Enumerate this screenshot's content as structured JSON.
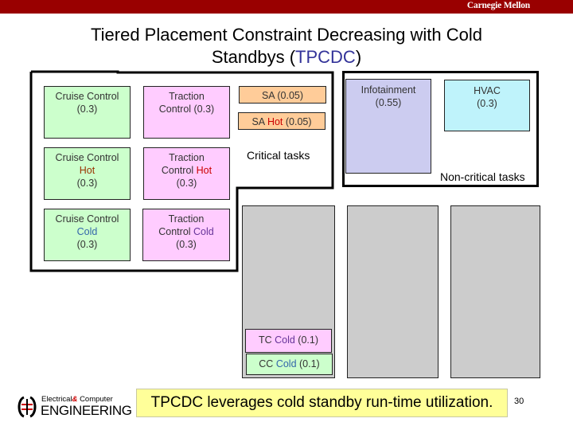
{
  "header": {
    "brand": "Carnegie Mellon",
    "brand_bar_color": "#990000"
  },
  "title": {
    "line1": "Tiered Placement Constraint Decreasing with Cold",
    "line2_prefix": "Standbys (",
    "line2_accent": "TPCDC",
    "line2_suffix": ")",
    "accent_color": "#333399"
  },
  "critical": {
    "label": "Critical tasks",
    "tasks": [
      {
        "name": "Cruise Control",
        "suffix": "(0.3)"
      },
      {
        "name": "Traction",
        "name2": "Control (0.3)"
      },
      {
        "name": "SA (0.05)"
      },
      {
        "prefix": "SA ",
        "tag": "Hot",
        "suffix": " (0.05)"
      },
      {
        "name": "Cruise Control",
        "tag": "Hot",
        "suffix": "(0.3)"
      },
      {
        "name": "Traction",
        "name2": "Control ",
        "tag": "Hot",
        "suffix": "(0.3)"
      },
      {
        "name": "Cruise Control",
        "tag": "Cold",
        "suffix": "(0.3)"
      },
      {
        "name": "Traction",
        "name2": "Control ",
        "tag": "Cold",
        "suffix": "(0.3)"
      }
    ]
  },
  "noncritical": {
    "label": "Non-critical tasks",
    "tasks": [
      {
        "name": "Infotainment",
        "suffix": "(0.55)"
      },
      {
        "name": "HVAC",
        "suffix": "(0.3)"
      }
    ]
  },
  "processors": {
    "cold_standbys": [
      {
        "prefix": "TC ",
        "tag": "Cold",
        "suffix": " (0.1)"
      },
      {
        "prefix": "CC ",
        "tag": "Cold",
        "suffix": " (0.1)"
      }
    ]
  },
  "callout": "TPCDC leverages cold standby run-time utilization.",
  "page_number": "30",
  "footer_logo": {
    "line1_a": "Electrical",
    "line1_amp": "&",
    "line1_b": "Computer",
    "line2": "ENGINEERING"
  }
}
